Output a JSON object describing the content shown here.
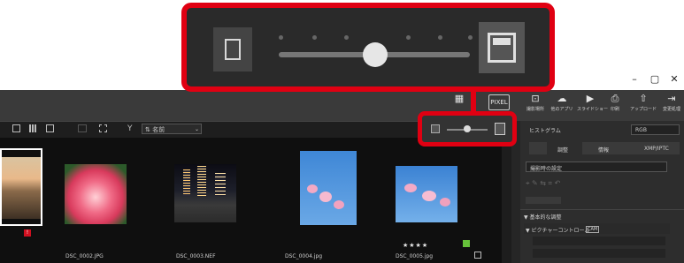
{
  "window": {
    "minimize": "–",
    "maximize": "▢",
    "close": "✕"
  },
  "toolbar": {
    "buttons": [
      {
        "icon": "▦",
        "label": ""
      },
      {
        "icon": "PIXEL",
        "label": ""
      },
      {
        "icon": "⊡",
        "label": "撮影場所"
      },
      {
        "icon": "☁",
        "label": "他のアプリ"
      },
      {
        "icon": "▶",
        "label": "スライドショー"
      },
      {
        "icon": "⎙",
        "label": "印刷"
      },
      {
        "icon": "⇧",
        "label": "アップロード"
      },
      {
        "icon": "⇥",
        "label": "変更処理"
      }
    ]
  },
  "viewbar": {
    "sort_label": "⇅ 名前",
    "filter_icon": "Y"
  },
  "thumbnails": [
    {
      "filename": "",
      "kind": "landscape",
      "badge": "!"
    },
    {
      "filename": "DSC_0002.JPG",
      "kind": "flower"
    },
    {
      "filename": "DSC_0003.NEF",
      "kind": "city"
    },
    {
      "filename": "DSC_0004.jpg",
      "kind": "sakura-portrait"
    },
    {
      "filename": "DSC_0005.jpg",
      "kind": "sakura-landscape",
      "rating": "★★★★"
    }
  ],
  "right_panel": {
    "histogram_label": "ヒストグラム",
    "channel": "RGB",
    "tabs": [
      "調整",
      "情報",
      "XMP/IPTC"
    ],
    "preset": "撮影時の設定",
    "basic_adjust": "▼ 基本的な調整",
    "picture_control": "▼ ピクチャーコントロール",
    "picture_control_badge": "CAM"
  },
  "thumb_size_slider": {
    "value": 0.5
  }
}
